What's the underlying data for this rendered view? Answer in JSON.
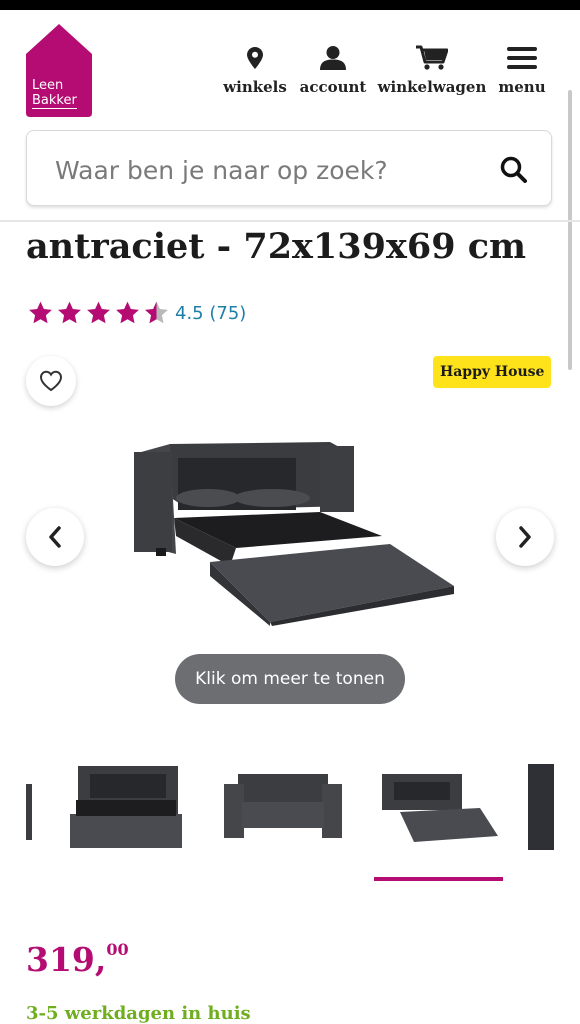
{
  "colors": {
    "brand": "#b40c72",
    "rating_link": "#1f7fa6",
    "badge_bg": "#ffe31a",
    "delivery": "#6fae1f"
  },
  "logo": {
    "line1": "Leen",
    "line2": "Bakker"
  },
  "nav": {
    "stores": {
      "label": "winkels",
      "icon": "map-pin-icon"
    },
    "account": {
      "label": "account",
      "icon": "user-icon"
    },
    "cart": {
      "label": "winkelwagen",
      "icon": "cart-icon"
    },
    "menu": {
      "label": "menu",
      "icon": "hamburger-icon"
    }
  },
  "search": {
    "placeholder": "Waar ben je naar op zoek?",
    "value": "",
    "icon": "search-icon"
  },
  "product": {
    "title": "antraciet - 72x139x69 cm",
    "rating_value": 4.5,
    "rating_max": 5,
    "rating_text": "4.5 (75)",
    "brand_badge": "Happy House",
    "favorite_icon": "heart-icon",
    "show_more_label": "Klik om meer te tonen",
    "thumbnails_count_visible": 5,
    "active_thumbnail": 4,
    "price_main": "319,",
    "price_cents": "00",
    "delivery": "3-5 werkdagen in huis"
  }
}
